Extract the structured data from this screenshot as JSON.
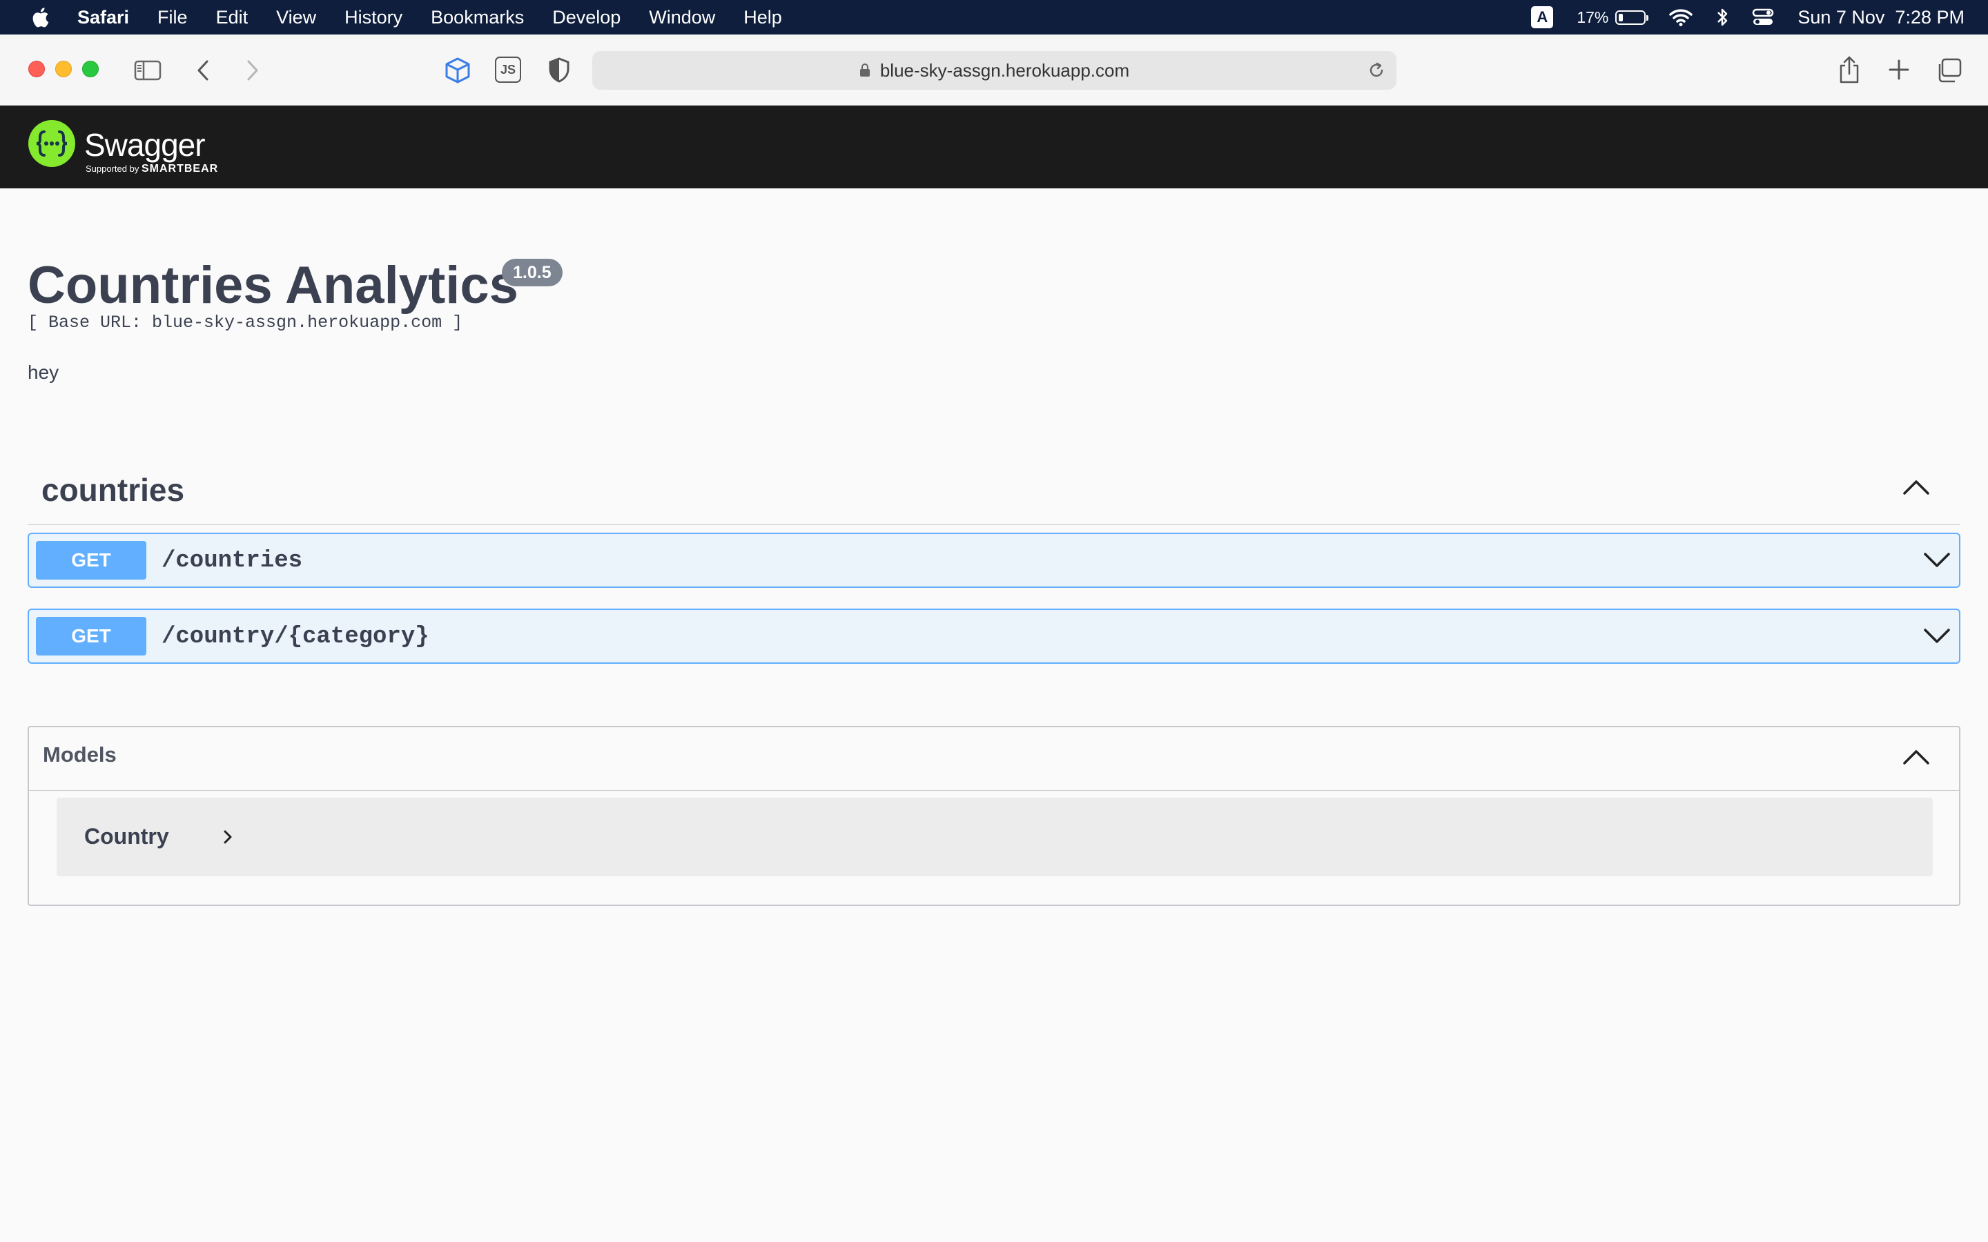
{
  "menubar": {
    "app": "Safari",
    "items": [
      "File",
      "Edit",
      "View",
      "History",
      "Bookmarks",
      "Develop",
      "Window",
      "Help"
    ],
    "keyboard_badge": "A",
    "battery_percent": "17%",
    "battery_level": 0.17,
    "datetime": "Sun 7 Nov  7:28 PM"
  },
  "browser": {
    "url": "blue-sky-assgn.herokuapp.com",
    "js_badge": "JS"
  },
  "swagger": {
    "logo_text": "Swagger",
    "supported_by": "Supported by",
    "smartbear": "SMARTBEAR"
  },
  "info": {
    "title": "Countries Analytics",
    "version": "1.0.5",
    "base_url": "[ Base URL: blue-sky-assgn.herokuapp.com ]",
    "description": "hey"
  },
  "tag": {
    "name": "countries",
    "operations": [
      {
        "method": "GET",
        "path": "/countries"
      },
      {
        "method": "GET",
        "path": "/country/{category}"
      }
    ]
  },
  "models": {
    "title": "Models",
    "items": [
      {
        "name": "Country"
      }
    ]
  },
  "colors": {
    "get_method": "#61affe",
    "get_background": "#ebf3fb",
    "swagger_header": "#1b1b1b",
    "swagger_green": "#85ea2d",
    "menubar": "#0f1e3d"
  }
}
